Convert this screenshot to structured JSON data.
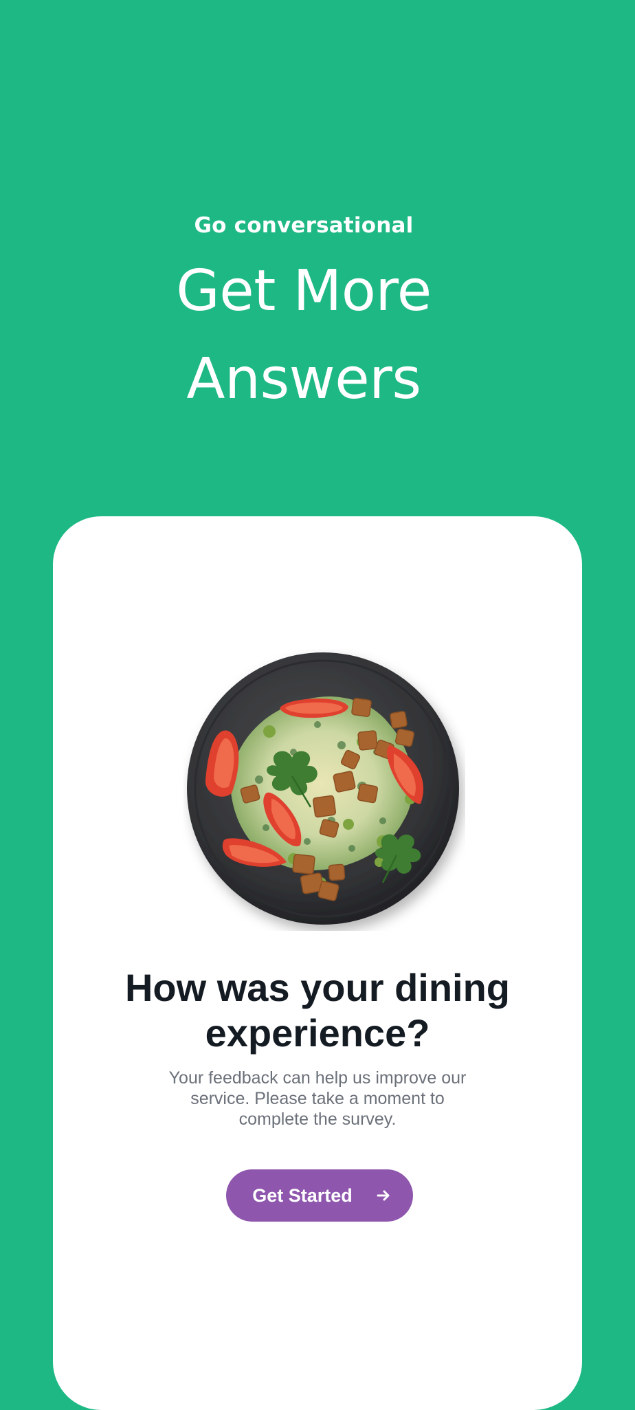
{
  "hero": {
    "eyebrow": "Go conversational",
    "headline_line1": "Get More",
    "headline_line2": "Answers"
  },
  "card": {
    "image_alt": "Plate of salad with tomatoes, croutons and parsley",
    "title_line1": "How was your dining",
    "title_line2": "experience?",
    "desc_line1": "Your feedback can help us improve our",
    "desc_line2": "service. Please take a moment to",
    "desc_line3": "complete the survey.",
    "cta_label": "Get Started",
    "cta_icon": "arrow-right-icon"
  },
  "colors": {
    "background": "#1db884",
    "card": "#ffffff",
    "cta": "#8e56ad",
    "title": "#141b22",
    "body_text": "#6b7079"
  }
}
